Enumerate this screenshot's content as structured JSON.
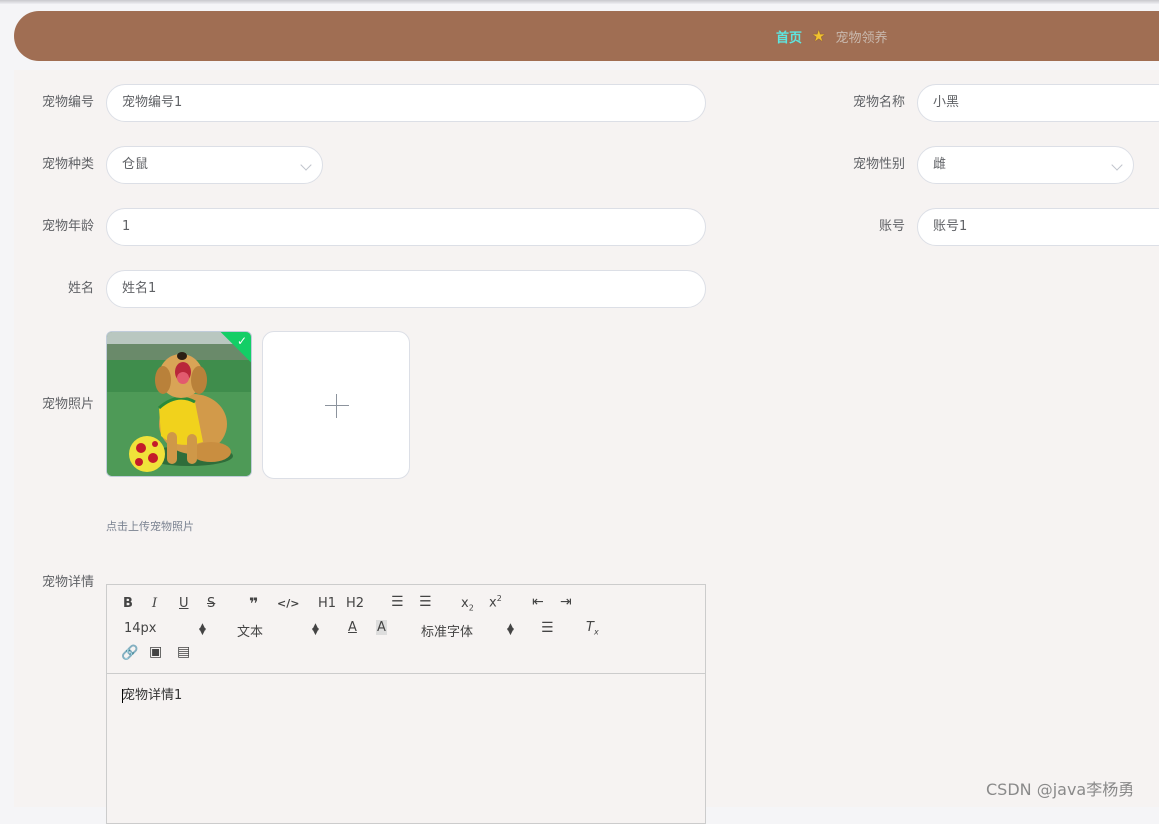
{
  "breadcrumb": {
    "home": "首页",
    "current": "宠物领养"
  },
  "form": {
    "pet_no": {
      "label": "宠物编号",
      "value": "宠物编号1"
    },
    "pet_name": {
      "label": "宠物名称",
      "value": "小黑"
    },
    "pet_type": {
      "label": "宠物种类",
      "value": "仓鼠"
    },
    "pet_gender": {
      "label": "宠物性别",
      "value": "雌"
    },
    "pet_age": {
      "label": "宠物年龄",
      "value": "1"
    },
    "account": {
      "label": "账号",
      "value": "账号1"
    },
    "name": {
      "label": "姓名",
      "value": "姓名1"
    },
    "photo": {
      "label": "宠物照片",
      "tip": "点击上传宠物照片"
    },
    "detail": {
      "label": "宠物详情",
      "value": "宠物详情1"
    }
  },
  "editor": {
    "font_size": "14px",
    "header_select": "文本",
    "font_family": "标准字体",
    "h1": "H1",
    "h2": "H2"
  },
  "watermark": "CSDN @java李杨勇",
  "colors": {
    "header": "#a06e53",
    "breadcrumb_home": "#5ee6e0",
    "success": "#13ce66"
  }
}
